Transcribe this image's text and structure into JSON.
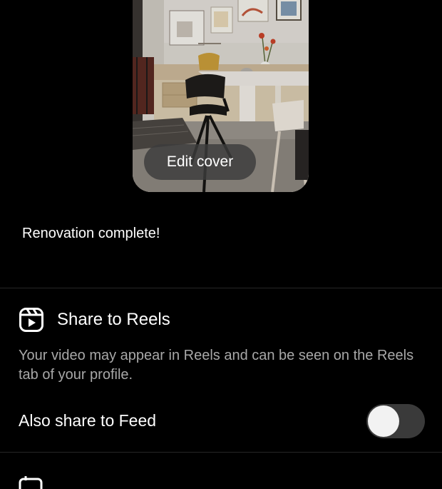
{
  "cover": {
    "edit_label": "Edit cover"
  },
  "caption": {
    "text": "Renovation complete!"
  },
  "share_reels": {
    "icon": "reels-icon",
    "title": "Share to Reels",
    "description": "Your video may appear in Reels and can be seen on the Reels tab of your profile."
  },
  "feed_share": {
    "label": "Also share to Feed",
    "enabled": false
  },
  "colors": {
    "background": "#000000",
    "text_primary": "#ffffff",
    "text_secondary": "#a8a8a8",
    "toggle_off": "#3a3a3a",
    "divider": "#262626"
  }
}
